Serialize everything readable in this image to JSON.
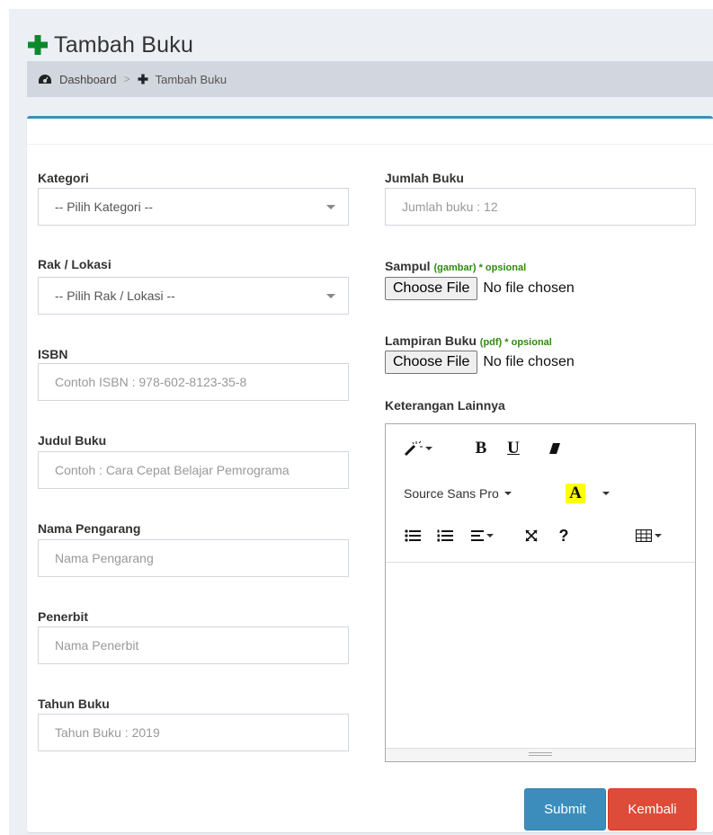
{
  "page": {
    "title": "Tambah Buku",
    "icon": "plus-icon"
  },
  "breadcrumb": {
    "home_label": "Dashboard",
    "separator": ">",
    "current_label": "Tambah Buku"
  },
  "form": {
    "kategori": {
      "label": "Kategori",
      "selected": "-- Pilih Kategori --"
    },
    "rak": {
      "label": "Rak / Lokasi",
      "selected": "-- Pilih Rak / Lokasi --"
    },
    "isbn": {
      "label": "ISBN",
      "placeholder": "Contoh ISBN : 978-602-8123-35-8"
    },
    "judul": {
      "label": "Judul Buku",
      "placeholder": "Contoh : Cara Cepat Belajar Pemrograma"
    },
    "pengarang": {
      "label": "Nama Pengarang",
      "placeholder": "Nama Pengarang"
    },
    "penerbit": {
      "label": "Penerbit",
      "placeholder": "Nama Penerbit"
    },
    "tahun": {
      "label": "Tahun Buku",
      "placeholder": "Tahun Buku : 2019"
    },
    "jumlah": {
      "label": "Jumlah Buku",
      "placeholder": "Jumlah buku : 12"
    },
    "sampul": {
      "label": "Sampul",
      "hint": "(gambar) * opsional",
      "button": "Choose File",
      "status": "No file chosen"
    },
    "lampiran": {
      "label": "Lampiran Buku",
      "hint": "(pdf) * opsional",
      "button": "Choose File",
      "status": "No file chosen"
    },
    "keterangan": {
      "label": "Keterangan Lainnya"
    }
  },
  "editor": {
    "toolbar": {
      "style_icon": "magic-wand-icon",
      "bold": "B",
      "underline": "U",
      "eraser_icon": "eraser-icon",
      "font_name": "Source Sans Pro",
      "font_color_label": "A",
      "font_color_highlight": "#ffff00",
      "ul_icon": "unordered-list-icon",
      "ol_icon": "ordered-list-icon",
      "align_icon": "align-icon",
      "fullscreen_icon": "fullscreen-icon",
      "help": "?",
      "table_icon": "table-icon"
    }
  },
  "actions": {
    "submit": "Submit",
    "back": "Kembali"
  },
  "colors": {
    "plus_icon": "#0a8a2a",
    "primary": "#3c8dbc",
    "danger": "#dd4b39",
    "hint": "#2e8b0f"
  }
}
